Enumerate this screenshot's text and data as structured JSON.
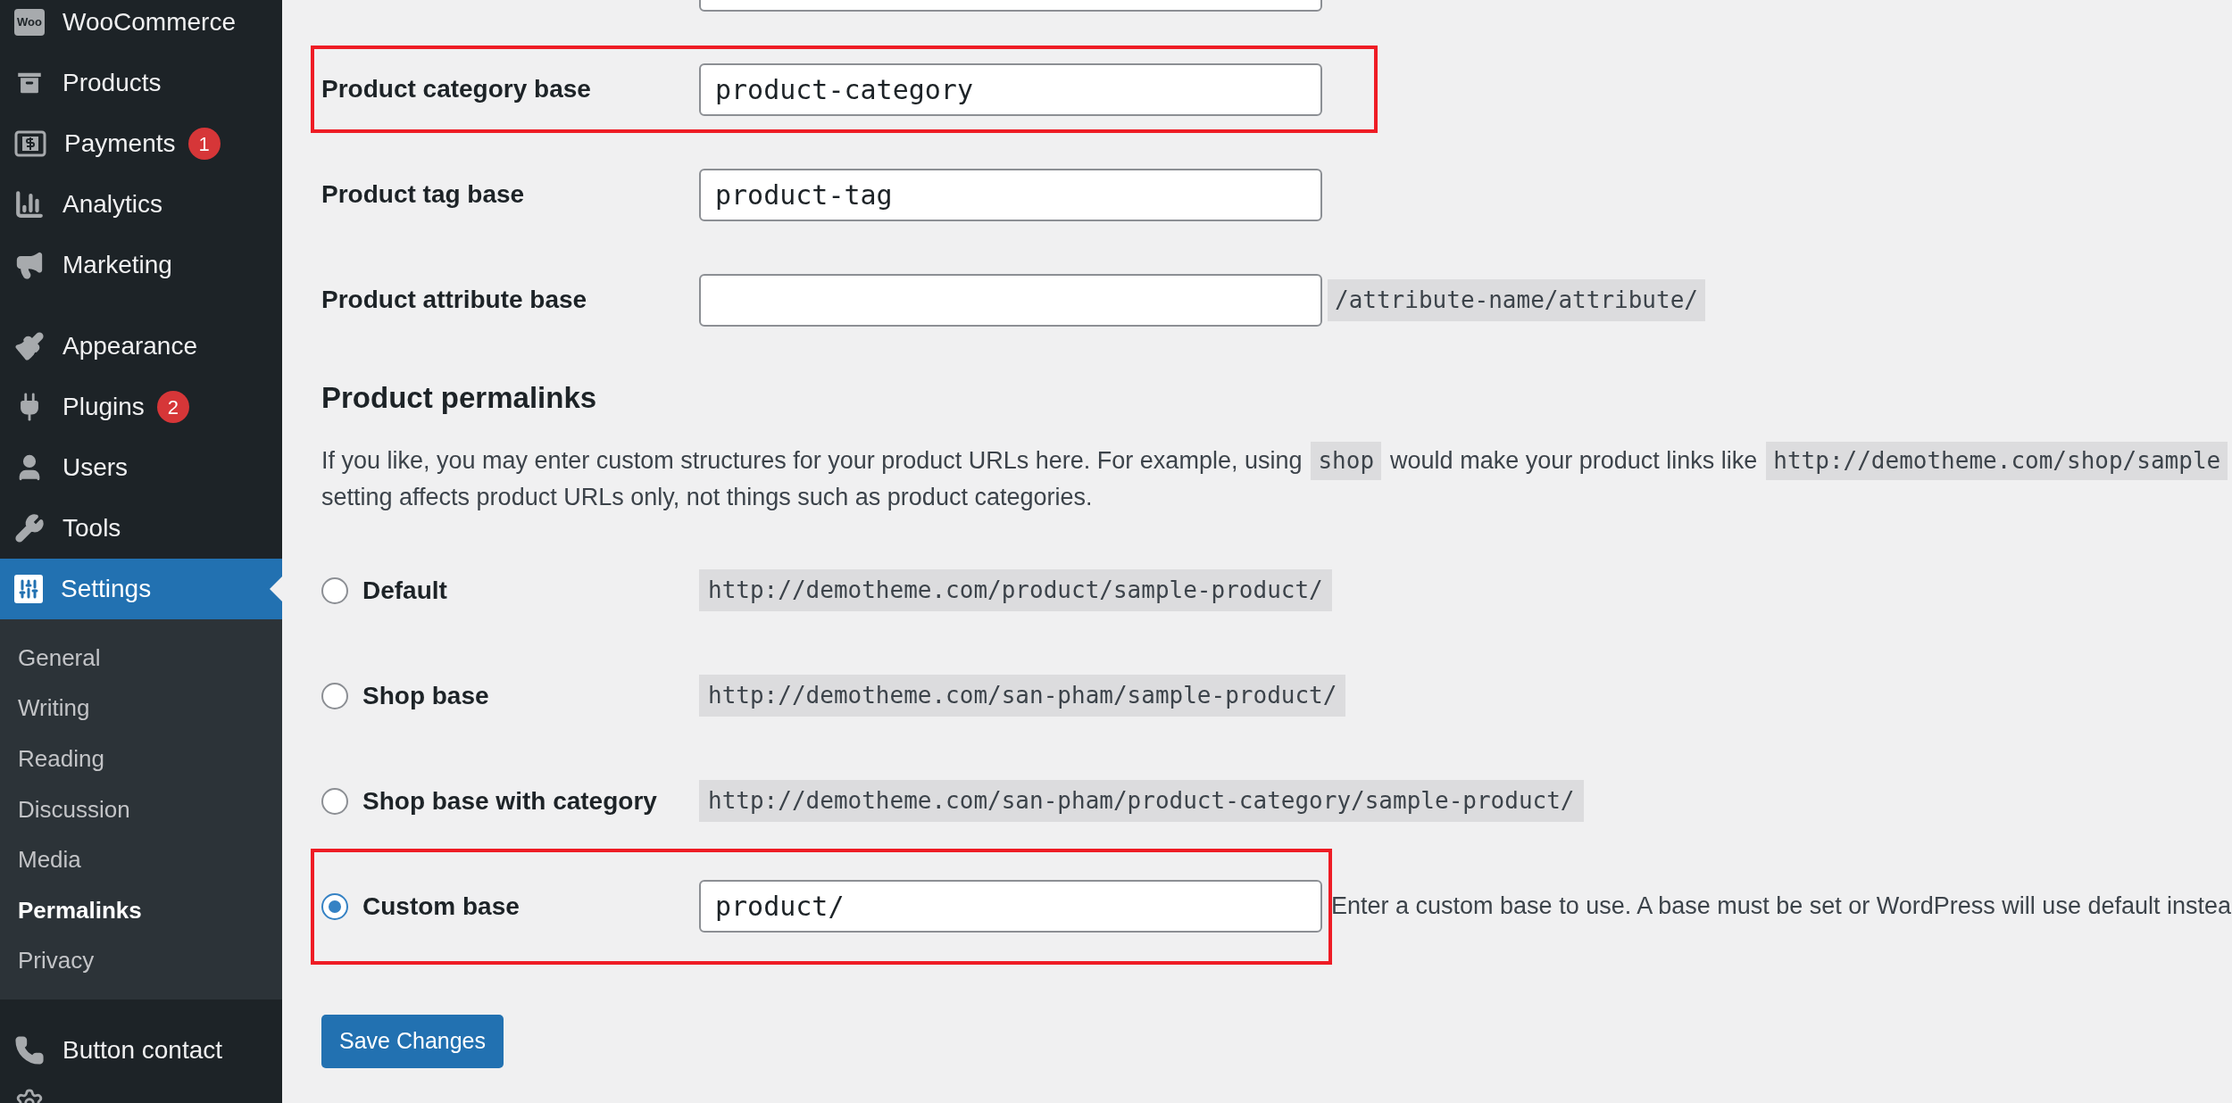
{
  "sidebar": {
    "groups": [
      [
        {
          "label": "WooCommerce",
          "logo_text": "Woo",
          "selected": false
        },
        {
          "label": "Products",
          "selected": false
        },
        {
          "label": "Payments",
          "badge": "1",
          "selected": false
        },
        {
          "label": "Analytics",
          "selected": false
        },
        {
          "label": "Marketing",
          "selected": false
        }
      ],
      [
        {
          "label": "Appearance",
          "selected": false
        },
        {
          "label": "Plugins",
          "badge": "2",
          "selected": false
        },
        {
          "label": "Users",
          "selected": false
        },
        {
          "label": "Tools",
          "selected": false
        },
        {
          "label": "Settings",
          "selected": true,
          "children": [
            {
              "label": "General",
              "selected": false
            },
            {
              "label": "Writing",
              "selected": false
            },
            {
              "label": "Reading",
              "selected": false
            },
            {
              "label": "Discussion",
              "selected": false
            },
            {
              "label": "Media",
              "selected": false
            },
            {
              "label": "Permalinks",
              "selected": true
            },
            {
              "label": "Privacy",
              "selected": false
            }
          ]
        }
      ],
      [
        {
          "label": "Button contact",
          "selected": false
        }
      ]
    ]
  },
  "optional_fields": [
    {
      "label": "Product category base",
      "value": "product-category",
      "highlighted": true
    },
    {
      "label": "Product tag base",
      "value": "product-tag",
      "highlighted": false
    },
    {
      "label": "Product attribute base",
      "suffix": "/attribute-name/attribute/",
      "highlighted": false
    }
  ],
  "section": {
    "title": "Product permalinks",
    "line_1": [
      {
        "kind": "text",
        "text": "If you like, you may enter custom structures for your product URLs here. For example, using"
      },
      {
        "kind": "code",
        "text": "shop"
      },
      {
        "kind": "text",
        "text": "would make your product links like"
      },
      {
        "kind": "code",
        "text": "http://demotheme.com/shop/sample"
      }
    ],
    "line_2": "setting affects product URLs only, not things such as product categories."
  },
  "permalink_options": [
    {
      "kind": "preset",
      "label": "Default",
      "example": "http://demotheme.com/product/sample-product/",
      "selected": false,
      "highlighted": false
    },
    {
      "kind": "preset",
      "label": "Shop base",
      "example": "http://demotheme.com/san-pham/sample-product/",
      "selected": false,
      "highlighted": false
    },
    {
      "kind": "preset",
      "label": "Shop base with category",
      "example": "http://demotheme.com/san-pham/product-category/sample-product/",
      "selected": false,
      "highlighted": false
    },
    {
      "kind": "custom",
      "label": "Custom base",
      "value": "product/",
      "note": "Enter a custom base to use. A base must be set or WordPress will use default instea",
      "selected": true,
      "highlighted": true
    }
  ],
  "save_button": "Save Changes"
}
